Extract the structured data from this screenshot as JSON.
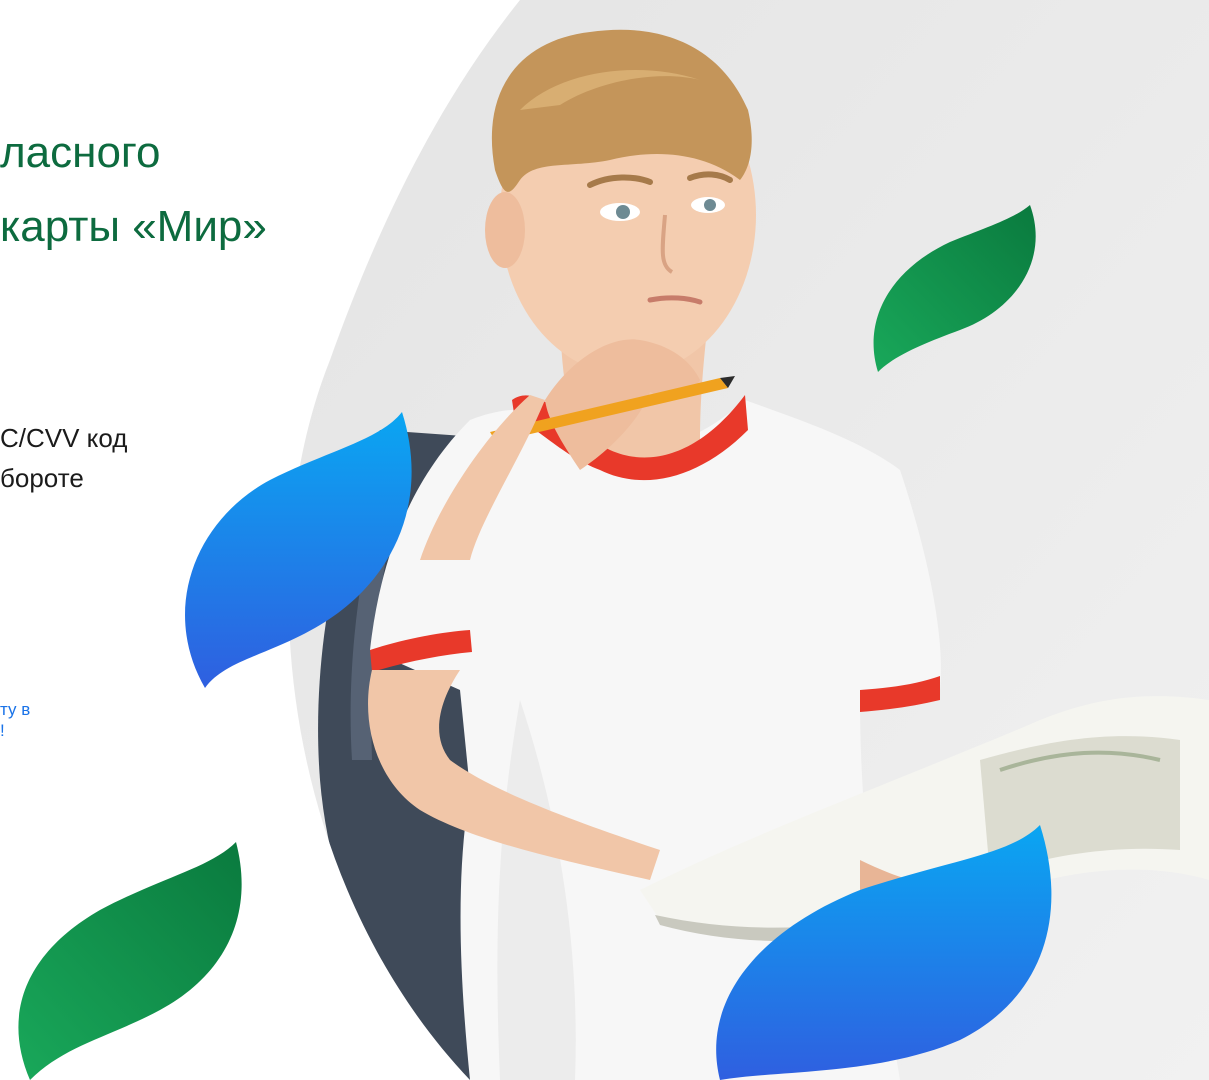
{
  "slide": {
    "title_lines": [
      "ласного",
      "карты «Мир»"
    ],
    "body_lines": [
      "C/CVV код",
      "бороте"
    ],
    "link_lines": [
      "ту в",
      "!"
    ]
  },
  "colors": {
    "title": "#0d6b3f",
    "body_text": "#1b1b1b",
    "link": "#1a73e8",
    "leaf_green_light": "#19a85a",
    "leaf_green_dark": "#0a7a3e",
    "leaf_blue_light": "#0aa6f2",
    "leaf_blue_dark": "#2f5fe0",
    "photo_background": "#e9e9e9"
  },
  "photo": {
    "subject": "teen-with-pencil-backpack-book"
  }
}
